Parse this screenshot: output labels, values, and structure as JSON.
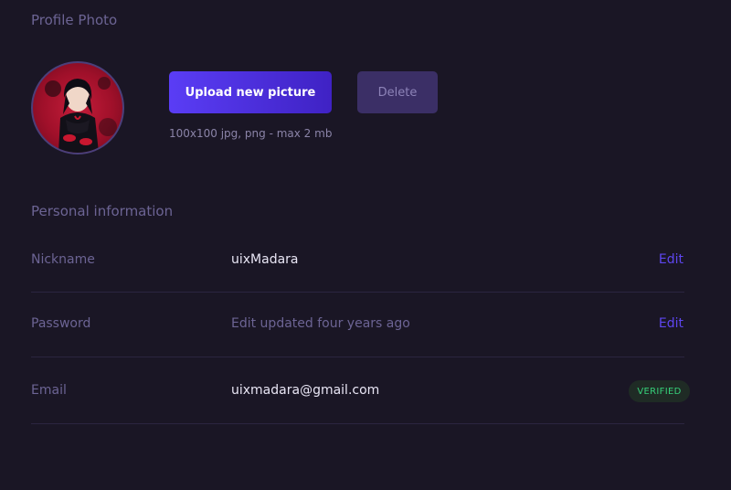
{
  "profile_photo": {
    "title": "Profile Photo",
    "upload_label": "Upload new picture",
    "delete_label": "Delete",
    "hint": "100x100 jpg, png - max 2 mb"
  },
  "personal_info": {
    "title": "Personal information",
    "rows": [
      {
        "label": "Nickname",
        "value": "uixMadara",
        "action": "Edit"
      },
      {
        "label": "Password",
        "value": "Edit updated four years ago",
        "action": "Edit"
      },
      {
        "label": "Email",
        "value": "uixmadara@gmail.com",
        "badge": "VERIFIED"
      }
    ]
  },
  "colors": {
    "background": "#1a1625",
    "accent": "#5e46f0",
    "muted_text": "#6c6494",
    "verified": "#37d17a"
  }
}
